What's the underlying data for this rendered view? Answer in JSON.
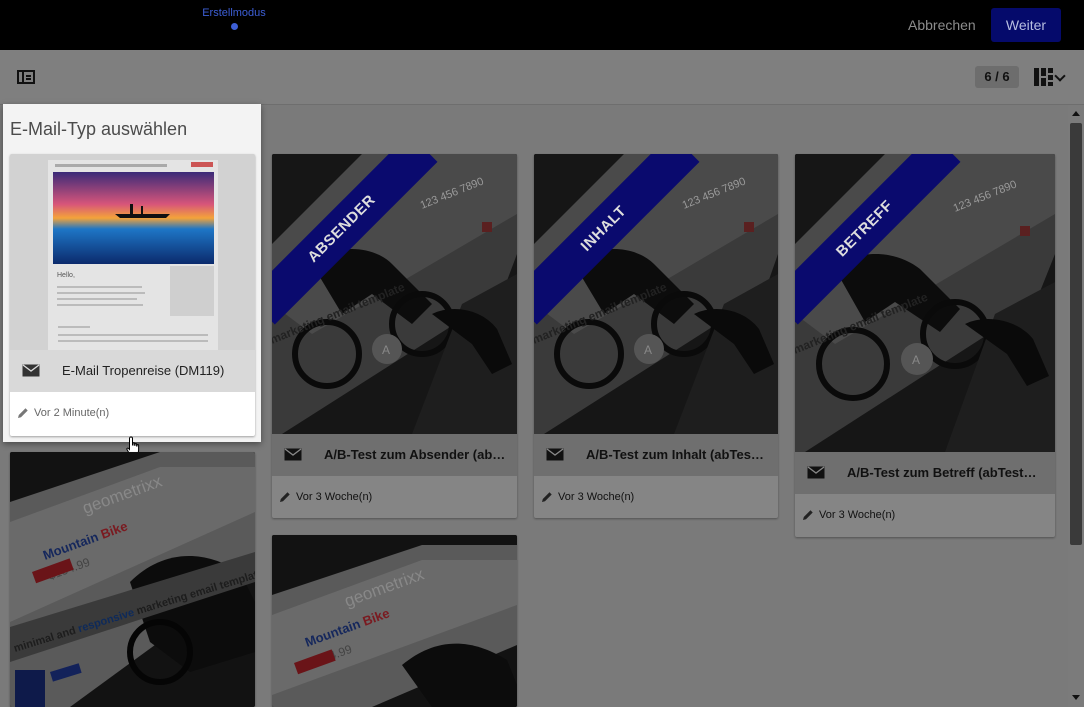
{
  "header": {
    "step_label": "Erstellmodus",
    "cancel_label": "Abbrechen",
    "next_label": "Weiter"
  },
  "toolbar": {
    "count": "6 / 6"
  },
  "dialog": {
    "title": "E-Mail-Typ auswählen"
  },
  "cards": [
    {
      "title": "E-Mail Tropenreise (DM119)",
      "modified": "Vor 2 Minute(n)",
      "selected": true,
      "preview_text": {
        "greeting": "Hello,"
      }
    },
    {
      "title": "A/B-Test zum Absender (abTes...",
      "modified": "Vor 3 Woche(n)",
      "banner": "ABSENDER"
    },
    {
      "title": "A/B-Test zum Inhalt (abTestCo...",
      "modified": "Vor 3 Woche(n)",
      "banner": "INHALT"
    },
    {
      "title": "A/B-Test zum Betreff (abTestSubj...",
      "modified": "Vor 3 Woche(n)",
      "banner": "BETREFF"
    }
  ],
  "template_preview": {
    "phone": "123 456 7890",
    "headline": "marketing email template",
    "badge": "A",
    "brand": "geometrixx",
    "product_a": "Mountain",
    "product_b": "Bike",
    "price": "$134.99",
    "tagline_a": "minimal and",
    "tagline_b": "responsive",
    "tagline_c": "marketing email template"
  },
  "colors": {
    "topbar": "#000000",
    "accent": "#3d5fd6",
    "primary_button": "#050a6b",
    "banner": "#0a0a6e",
    "brand_red": "#e0202a"
  },
  "icons": [
    "panel-toggle-icon",
    "grid-view-icon",
    "chevron-down-icon",
    "mail-icon",
    "pencil-icon",
    "hand-cursor-icon"
  ]
}
